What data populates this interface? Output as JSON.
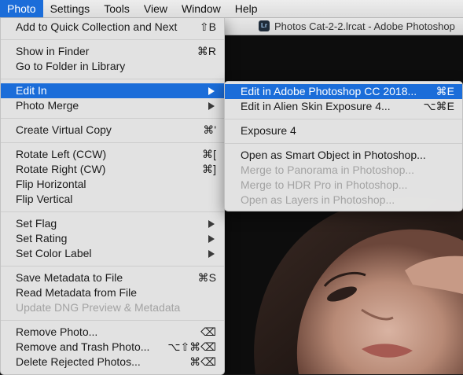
{
  "menubar": {
    "items": [
      {
        "label": "Photo",
        "active": true
      },
      {
        "label": "Settings"
      },
      {
        "label": "Tools"
      },
      {
        "label": "View"
      },
      {
        "label": "Window"
      },
      {
        "label": "Help"
      }
    ]
  },
  "window": {
    "title": "Photos Cat-2-2.lrcat - Adobe Photoshop",
    "badge": "Lr"
  },
  "photo_menu": {
    "add_quick": {
      "label": "Add to Quick Collection and Next",
      "shortcut": "⇧B"
    },
    "show_finder": {
      "label": "Show in Finder",
      "shortcut": "⌘R"
    },
    "go_folder": {
      "label": "Go to Folder in Library"
    },
    "edit_in": {
      "label": "Edit In"
    },
    "photo_merge": {
      "label": "Photo Merge"
    },
    "virtual_copy": {
      "label": "Create Virtual Copy",
      "shortcut": "⌘'"
    },
    "rotate_left": {
      "label": "Rotate Left (CCW)",
      "shortcut": "⌘["
    },
    "rotate_right": {
      "label": "Rotate Right (CW)",
      "shortcut": "⌘]"
    },
    "flip_h": {
      "label": "Flip Horizontal"
    },
    "flip_v": {
      "label": "Flip Vertical"
    },
    "set_flag": {
      "label": "Set Flag"
    },
    "set_rating": {
      "label": "Set Rating"
    },
    "set_color": {
      "label": "Set Color Label"
    },
    "save_meta": {
      "label": "Save Metadata to File",
      "shortcut": "⌘S"
    },
    "read_meta": {
      "label": "Read Metadata from File"
    },
    "update_dng": {
      "label": "Update DNG Preview & Metadata"
    },
    "remove": {
      "label": "Remove Photo...",
      "shortcut": "⌫"
    },
    "remove_trash": {
      "label": "Remove and Trash Photo...",
      "shortcut": "⌥⇧⌘⌫"
    },
    "delete_rejected": {
      "label": "Delete Rejected Photos...",
      "shortcut": "⌘⌫"
    }
  },
  "edit_in_submenu": {
    "photoshop": {
      "label": "Edit in Adobe Photoshop CC 2018...",
      "shortcut": "⌘E"
    },
    "alien_skin": {
      "label": "Edit in Alien Skin Exposure 4...",
      "shortcut": "⌥⌘E"
    },
    "exposure": {
      "label": "Exposure 4"
    },
    "smart_object": {
      "label": "Open as Smart Object in Photoshop..."
    },
    "panorama": {
      "label": "Merge to Panorama in Photoshop..."
    },
    "hdr": {
      "label": "Merge to HDR Pro in Photoshop..."
    },
    "layers": {
      "label": "Open as Layers in Photoshop..."
    }
  },
  "colors": {
    "highlight": "#1b6dd9",
    "menu_bg": "#e9e9e9",
    "disabled_text": "#a3a3a3"
  }
}
